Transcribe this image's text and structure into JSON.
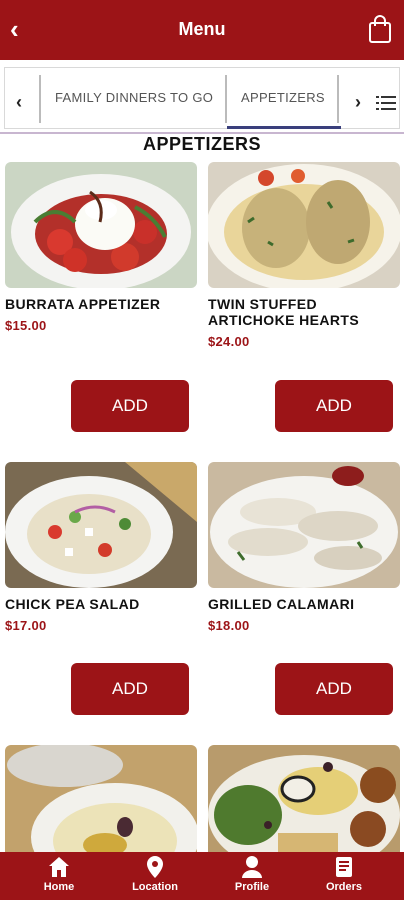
{
  "header": {
    "title": "Menu",
    "back_icon": "chevron-left-icon",
    "cart_icon": "shopping-bag-icon"
  },
  "tabs": {
    "items": [
      {
        "label": "FAMILY DINNERS TO GO",
        "active": false
      },
      {
        "label": "APPETIZERS",
        "active": true
      }
    ],
    "left_arrow": "‹",
    "right_arrow": "›"
  },
  "section": {
    "title": "APPETIZERS"
  },
  "items": [
    {
      "name": "BURRATA APPETIZER",
      "price": "$15.00",
      "button": "ADD"
    },
    {
      "name": "TWIN STUFFED ARTICHOKE HEARTS",
      "price": "$24.00",
      "button": "ADD"
    },
    {
      "name": "CHICK PEA SALAD",
      "price": "$17.00",
      "button": "ADD"
    },
    {
      "name": "GRILLED CALAMARI",
      "price": "$18.00",
      "button": "ADD"
    }
  ],
  "bottom_nav": [
    {
      "label": "Home",
      "icon": "home-icon"
    },
    {
      "label": "Location",
      "icon": "location-pin-icon"
    },
    {
      "label": "Profile",
      "icon": "person-icon"
    },
    {
      "label": "Orders",
      "icon": "receipt-icon"
    }
  ],
  "colors": {
    "brand": "#9c1417",
    "tab_underline": "#3a3f7c"
  }
}
